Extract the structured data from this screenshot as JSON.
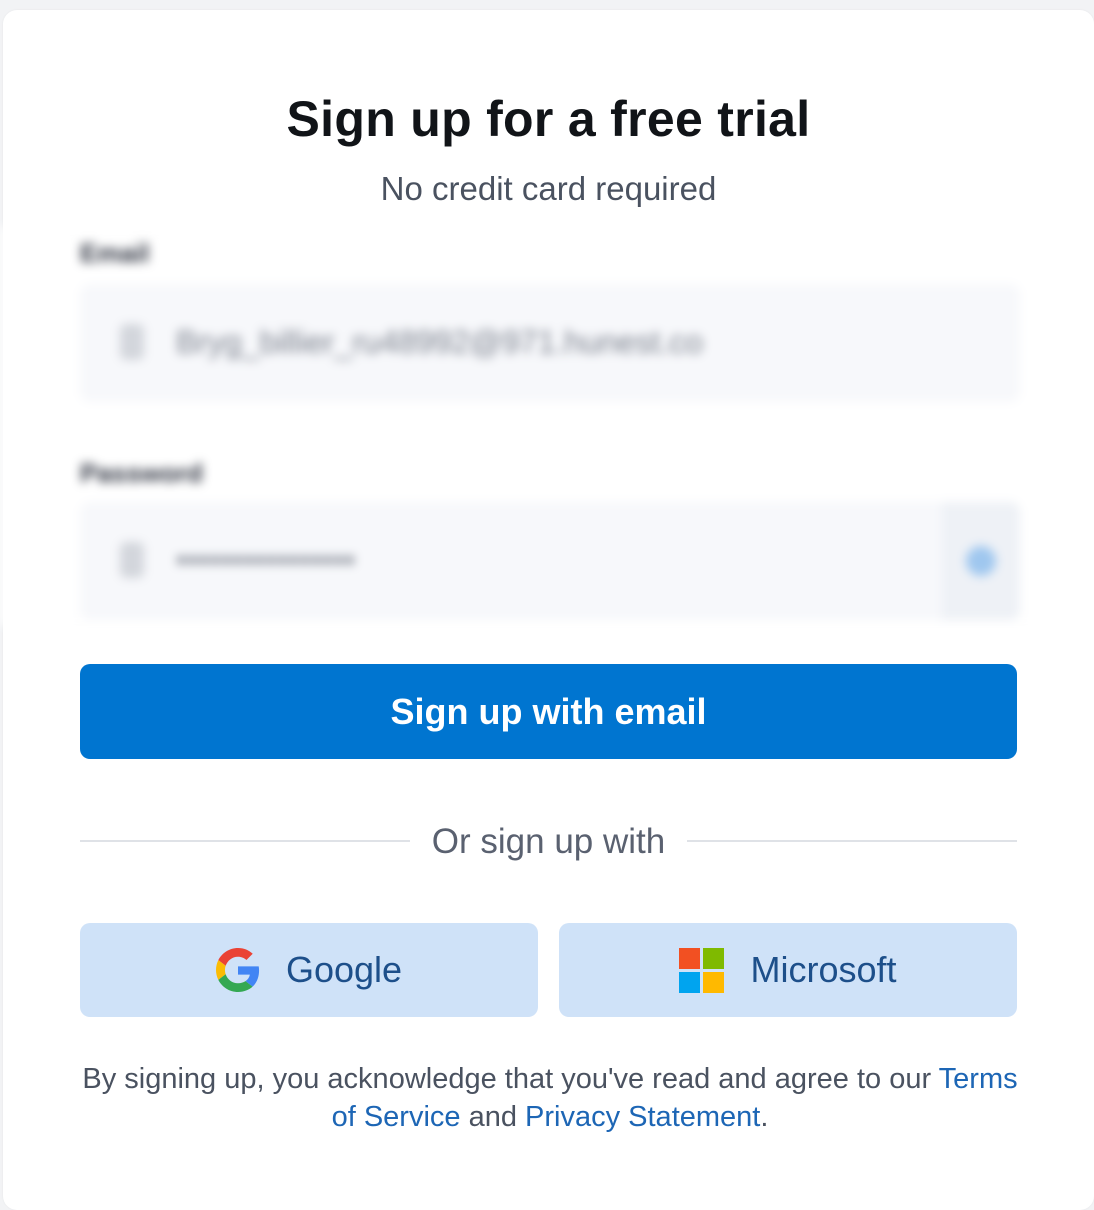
{
  "header": {
    "title": "Sign up for a free trial",
    "subtitle": "No credit card required"
  },
  "form": {
    "email": {
      "label": "Email",
      "value": "Bryg_billier_ru48992@971.hunest.co"
    },
    "password": {
      "label": "Password",
      "value": "••••••••••••••••"
    },
    "icons": {
      "email": "person-icon",
      "password": "lock-icon",
      "show_password": "eye-icon"
    }
  },
  "actions": {
    "signup_email": "Sign up with email",
    "divider": "Or sign up with",
    "google": "Google",
    "microsoft": "Microsoft"
  },
  "legal": {
    "prefix": "By signing up, you acknowledge that you've read and agree to our ",
    "terms_link": "Terms of Service",
    "middle": " and ",
    "privacy_link": "Privacy Statement",
    "suffix": "."
  },
  "colors": {
    "primary": "#0075d0",
    "social_bg": "#cfe2f8",
    "link": "#1d66b5"
  }
}
